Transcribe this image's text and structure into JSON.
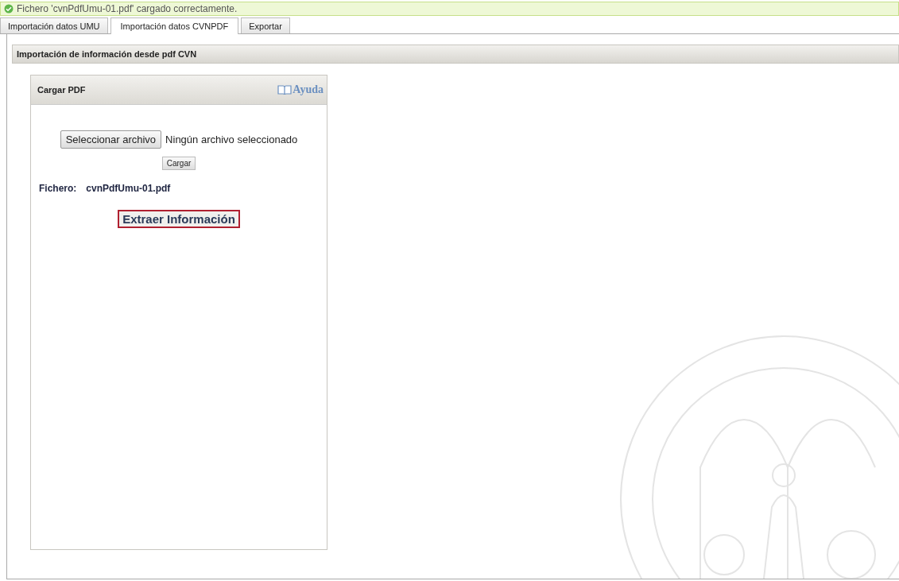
{
  "message": {
    "text": "Fichero 'cvnPdfUmu-01.pdf' cargado correctamente."
  },
  "tabs": [
    {
      "label": "Importación datos UMU",
      "selected": false
    },
    {
      "label": "Importación datos CVNPDF",
      "selected": true
    },
    {
      "label": "Exportar",
      "selected": false
    }
  ],
  "panel": {
    "title": "Importación de información desde pdf CVN"
  },
  "card": {
    "title": "Cargar PDF",
    "help_link": "Ayuda",
    "file_button": "Seleccionar archivo",
    "file_status": "Ningún archivo seleccionado",
    "upload_button": "Cargar",
    "file_label": "Fichero:",
    "file_name": "cvnPdfUmu-01.pdf",
    "extract_button": "Extraer Información"
  }
}
